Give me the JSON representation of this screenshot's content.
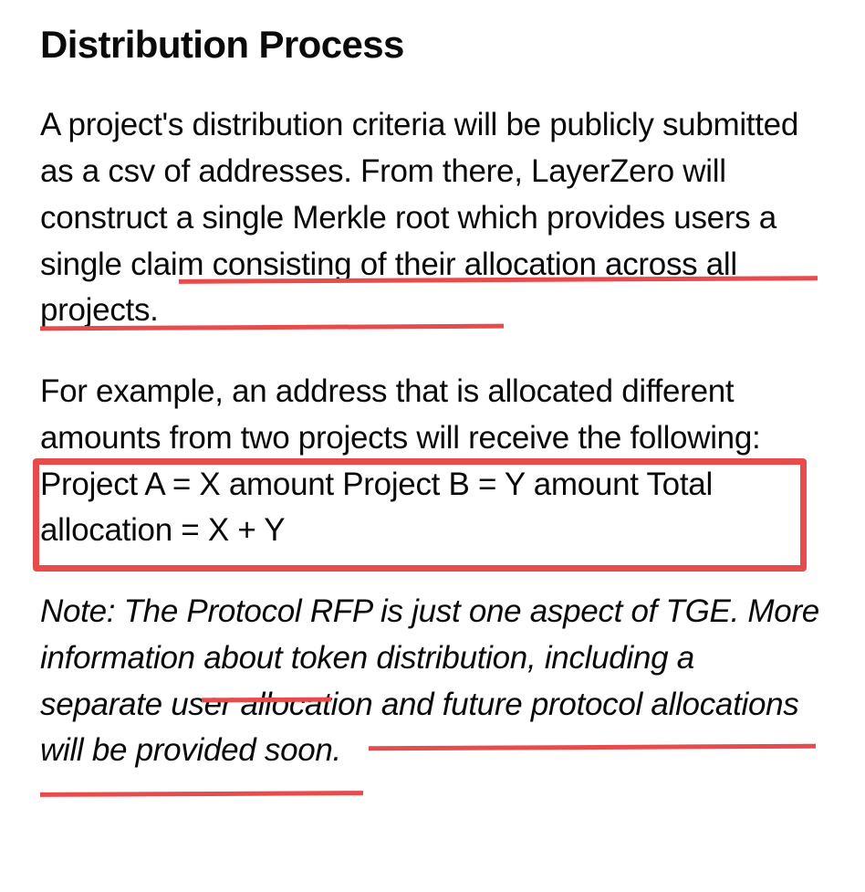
{
  "heading": "Distribution Process",
  "paragraph1": "A project's distribution criteria will be publicly submitted as a csv of addresses. From there, LayerZero will construct a single Merkle root which provides users a single claim consisting of their allocation across all projects.",
  "paragraph2": "For example, an address that is allocated different amounts from two projects will receive the following:  Project A = X amount Project B = Y amount Total allocation = X + Y",
  "note": "Note: The Protocol RFP is just one aspect of TGE. More information about token distribution, including a separate user allocation and future protocol allocations will be provided soon.",
  "annotations": {
    "color": "#e84b4b",
    "underlines": [
      "users a single claim consisting of their",
      "allocation across all projects.",
      "TGE. Mo",
      "including a separate",
      "user allocation and"
    ],
    "box_around": "following:  Project A = X amount Project B = Y amount Total allocation = X + Y"
  }
}
